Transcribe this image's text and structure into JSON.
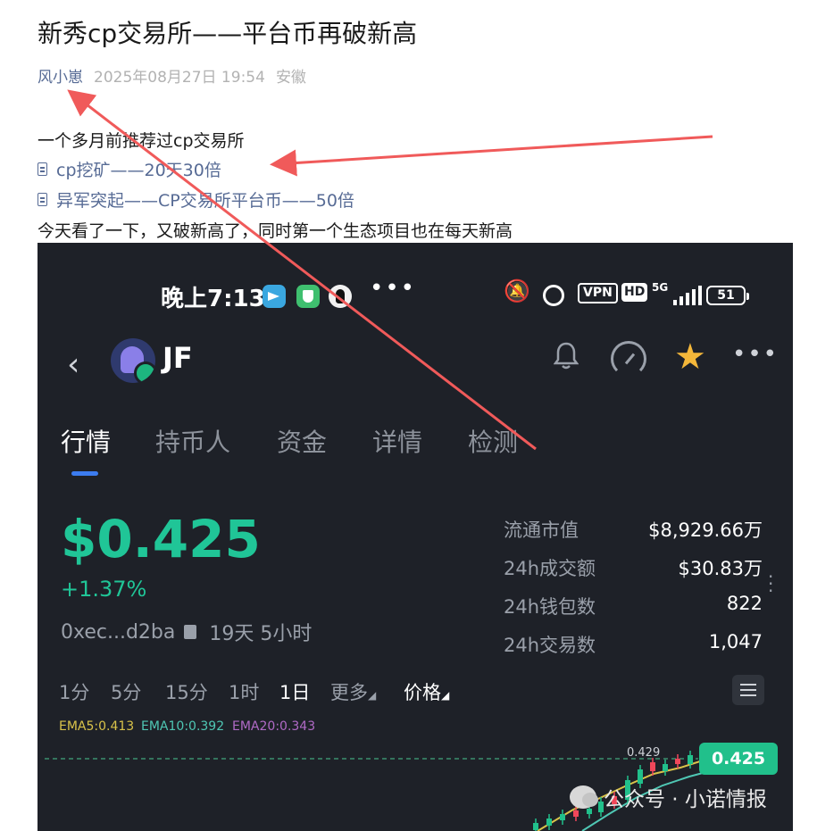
{
  "article": {
    "title": "新秀cp交易所——平台币再破新高",
    "author": "风小崽",
    "date": "2025年08月27日 19:54",
    "location": "安徽",
    "intro": "一个多月前推荐过cp交易所",
    "links": [
      "cp挖矿——20天30倍",
      "异军突起——CP交易所平台币——50倍"
    ],
    "body": "今天看了一下，又破新高了，同时第一个生态项目也在每天新高"
  },
  "phone": {
    "status_bar": {
      "time": "晚上7:13",
      "icons": [
        "telegram-icon",
        "shield-icon",
        "qq-icon",
        "more-dots-icon",
        "mute-icon",
        "alarm-icon"
      ],
      "vpn": "VPN",
      "hd": "HD",
      "network": "5G",
      "battery": "51"
    },
    "header": {
      "token": "JF",
      "icons": [
        "back-icon",
        "bell-icon",
        "gauge-icon",
        "star-icon",
        "more-icon"
      ]
    },
    "tabs": [
      "行情",
      "持币人",
      "资金",
      "详情",
      "检测"
    ],
    "active_tab": "行情",
    "price": "$0.425",
    "change": "+1.37%",
    "address": "0xec...d2ba",
    "age": "19天 5小时",
    "stats": [
      {
        "label": "流通市值",
        "value": "$8,929.66万"
      },
      {
        "label": "24h成交额",
        "value": "$30.83万"
      },
      {
        "label": "24h钱包数",
        "value": "822"
      },
      {
        "label": "24h交易数",
        "value": "1,047"
      }
    ],
    "intervals": [
      "1分",
      "5分",
      "15分",
      "1时",
      "1日",
      "更多",
      "价格"
    ],
    "active_interval": "1日",
    "ema": [
      {
        "text": "EMA5:0.413",
        "color": "#d9c34a"
      },
      {
        "text": "EMA10:0.392",
        "color": "#4fc7b4"
      },
      {
        "text": "EMA20:0.343",
        "color": "#b06ac6"
      }
    ],
    "chart": {
      "high_label": "0.429",
      "current_price_tag": "0.425",
      "up_color": "#21c08b",
      "down_color": "#f0475a"
    }
  },
  "watermark": {
    "text": "公众号 · 小诺情报"
  },
  "colors": {
    "link": "#576b95",
    "annotation_arrow": "#f05a5a",
    "phone_bg": "#1e2128",
    "accent_green": "#20c597"
  }
}
